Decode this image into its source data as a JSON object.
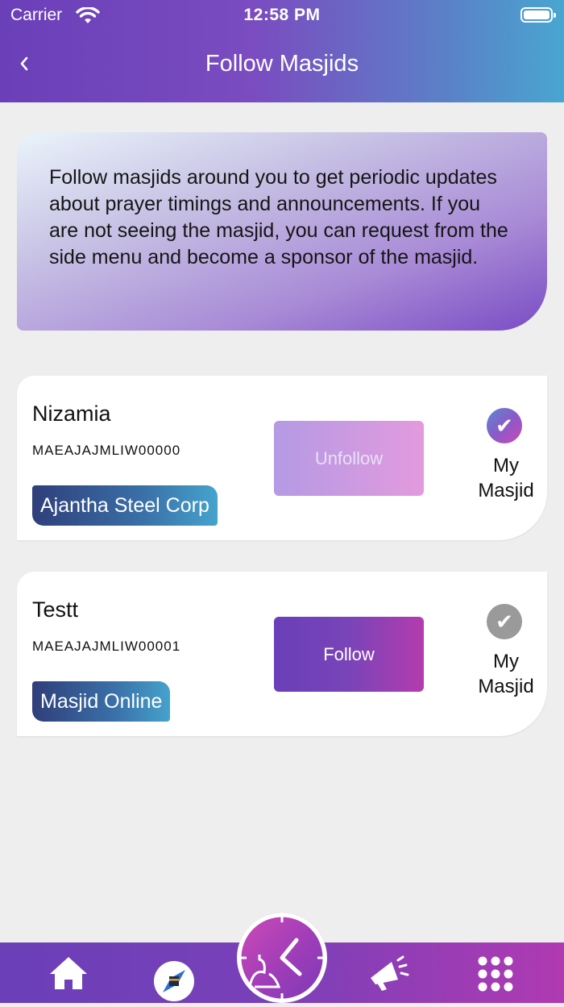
{
  "status_bar": {
    "carrier": "Carrier",
    "time": "12:58 PM"
  },
  "header": {
    "back_icon": "chevron-left-icon",
    "title": "Follow Masjids"
  },
  "info_text": "Follow masjids around you to get periodic updates about prayer timings and announcements. If you are not seeing the masjid, you can request from the side menu and become a sponsor of the masjid.",
  "masjids": [
    {
      "name": "Nizamia",
      "code": "MAEAJAJMLIW00000",
      "sponsor": "Ajantha Steel Corp",
      "button": "Unfollow",
      "my_masjid": "My Masjid",
      "is_my_masjid": true
    },
    {
      "name": "Testt",
      "code": "MAEAJAJMLIW00001",
      "sponsor": "Masjid Online",
      "button": "Follow",
      "my_masjid": "My Masjid",
      "is_my_masjid": false
    }
  ],
  "tabbar": {
    "items": [
      "home-icon",
      "qibla-compass-icon",
      "prayer-clock-icon",
      "announcement-icon",
      "grid-menu-icon"
    ]
  },
  "colors": {
    "primary": "#6a3fb8",
    "accent": "#b43cae",
    "header_end": "#48a6d0"
  }
}
